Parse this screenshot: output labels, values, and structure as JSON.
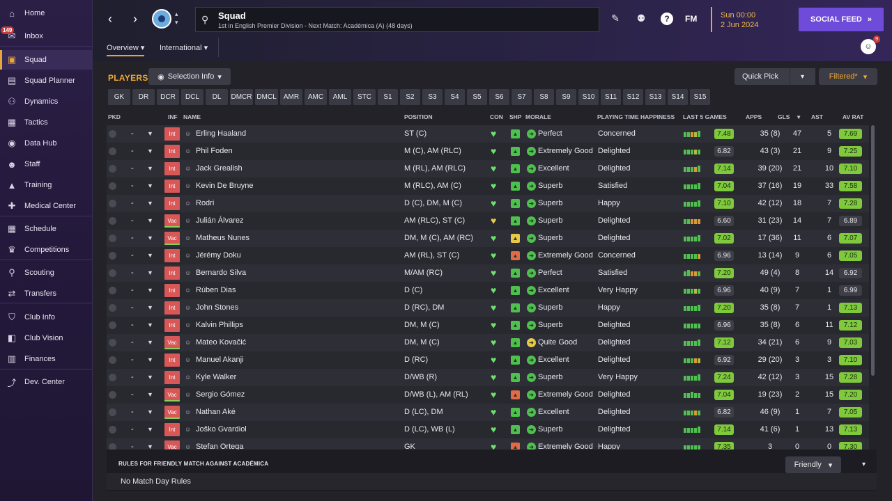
{
  "sidebar": {
    "items": [
      {
        "label": "Home",
        "icon": "home-icon",
        "glyph": "⌂"
      },
      {
        "label": "Inbox",
        "icon": "inbox-icon",
        "glyph": "✉",
        "badge": "149"
      },
      {
        "label": "Squad",
        "icon": "shirt-icon",
        "glyph": "▣",
        "active": true
      },
      {
        "label": "Squad Planner",
        "icon": "clipboard-icon",
        "glyph": "▤"
      },
      {
        "label": "Dynamics",
        "icon": "dynamics-icon",
        "glyph": "⚇"
      },
      {
        "label": "Tactics",
        "icon": "tactics-icon",
        "glyph": "▦"
      },
      {
        "label": "Data Hub",
        "icon": "data-hub-icon",
        "glyph": "◉"
      },
      {
        "label": "Staff",
        "icon": "staff-icon",
        "glyph": "☻"
      },
      {
        "label": "Training",
        "icon": "training-icon",
        "glyph": "▲"
      },
      {
        "label": "Medical Center",
        "icon": "medical-icon",
        "glyph": "✚"
      },
      {
        "label": "Schedule",
        "icon": "calendar-icon",
        "glyph": "▦"
      },
      {
        "label": "Competitions",
        "icon": "trophy-icon",
        "glyph": "♛"
      },
      {
        "label": "Scouting",
        "icon": "scouting-icon",
        "glyph": "⚲"
      },
      {
        "label": "Transfers",
        "icon": "transfers-icon",
        "glyph": "⇄"
      },
      {
        "label": "Club Info",
        "icon": "club-info-icon",
        "glyph": "⛉"
      },
      {
        "label": "Club Vision",
        "icon": "club-vision-icon",
        "glyph": "◧"
      },
      {
        "label": "Finances",
        "icon": "finances-icon",
        "glyph": "▥"
      },
      {
        "label": "Dev. Center",
        "icon": "dev-center-icon",
        "glyph": "⤴"
      }
    ]
  },
  "header": {
    "title": "Squad",
    "subtitle": "1st in English Premier Division - Next Match: Académica (A) (48 days)",
    "date_time": "Sun 00:00",
    "date": "2 Jun 2024",
    "social_label": "SOCIAL FEED",
    "fm_label": "FM",
    "help_label": "?",
    "notif_count": "9",
    "tabs": [
      {
        "label": "Overview"
      },
      {
        "label": "International"
      }
    ]
  },
  "toolbar": {
    "players_title": "PLAYERS",
    "selection_info": "Selection Info",
    "quick_pick": "Quick Pick",
    "filtered": "Filtered*",
    "positions": [
      "GK",
      "DR",
      "DCR",
      "DCL",
      "DL",
      "DMCR",
      "DMCL",
      "AMR",
      "AMC",
      "AML",
      "STC",
      "S1",
      "S2",
      "S3",
      "S4",
      "S5",
      "S6",
      "S7",
      "S8",
      "S9",
      "S10",
      "S11",
      "S12",
      "S13",
      "S14",
      "S15"
    ]
  },
  "table": {
    "columns": {
      "pkd": "PKD",
      "inf": "INF",
      "name": "NAME",
      "position": "POSITION",
      "con": "CON",
      "shp": "SHP",
      "morale": "MORALE",
      "pth": "PLAYING TIME HAPPINESS",
      "last5": "LAST 5 GAMES",
      "apps": "APPS",
      "gls": "GLS",
      "ast": "AST",
      "avrat": "AV RAT"
    },
    "rows": [
      {
        "dash": "-",
        "inf": "Int",
        "name": "Erling Haaland",
        "position": "ST (C)",
        "morale": "Perfect",
        "pth": "Concerned",
        "form": "7.48",
        "apps": "35 (8)",
        "gls": "47",
        "ast": "5",
        "avrat": "7.69"
      },
      {
        "dash": "-",
        "inf": "Int",
        "name": "Phil Foden",
        "position": "M (C), AM (RLC)",
        "morale": "Extremely Good",
        "pth": "Delighted",
        "form": "6.82",
        "apps": "43 (3)",
        "gls": "21",
        "ast": "9",
        "avrat": "7.25"
      },
      {
        "dash": "-",
        "inf": "Int",
        "name": "Jack Grealish",
        "position": "M (RL), AM (RLC)",
        "morale": "Excellent",
        "pth": "Delighted",
        "form": "7.14",
        "apps": "39 (20)",
        "gls": "21",
        "ast": "10",
        "avrat": "7.10"
      },
      {
        "dash": "-",
        "inf": "Int",
        "name": "Kevin De Bruyne",
        "position": "M (RLC), AM (C)",
        "morale": "Superb",
        "pth": "Satisfied",
        "form": "7.04",
        "apps": "37 (16)",
        "gls": "19",
        "ast": "33",
        "avrat": "7.58"
      },
      {
        "dash": "-",
        "inf": "Int",
        "name": "Rodri",
        "position": "D (C), DM, M (C)",
        "morale": "Superb",
        "pth": "Happy",
        "form": "7.10",
        "apps": "42 (12)",
        "gls": "18",
        "ast": "7",
        "avrat": "7.28"
      },
      {
        "dash": "-",
        "inf": "Vac",
        "name": "Julián Álvarez",
        "position": "AM (RLC), ST (C)",
        "morale": "Superb",
        "pth": "Delighted",
        "form": "6.60",
        "apps": "31 (23)",
        "gls": "14",
        "ast": "7",
        "avrat": "6.89"
      },
      {
        "dash": "-",
        "inf": "Vac",
        "name": "Matheus Nunes",
        "position": "DM, M (C), AM (RC)",
        "morale": "Superb",
        "pth": "Delighted",
        "form": "7.02",
        "apps": "17 (36)",
        "gls": "11",
        "ast": "6",
        "avrat": "7.07"
      },
      {
        "dash": "-",
        "inf": "Int",
        "name": "Jérémy Doku",
        "position": "AM (RL), ST (C)",
        "morale": "Extremely Good",
        "pth": "Concerned",
        "form": "6.96",
        "apps": "13 (14)",
        "gls": "9",
        "ast": "6",
        "avrat": "7.05"
      },
      {
        "dash": "-",
        "inf": "Int",
        "name": "Bernardo Silva",
        "position": "M/AM (RC)",
        "morale": "Perfect",
        "pth": "Satisfied",
        "form": "7.20",
        "apps": "49 (4)",
        "gls": "8",
        "ast": "14",
        "avrat": "6.92"
      },
      {
        "dash": "-",
        "inf": "Int",
        "name": "Rúben Dias",
        "position": "D (C)",
        "morale": "Excellent",
        "pth": "Very Happy",
        "form": "6.96",
        "apps": "40 (9)",
        "gls": "7",
        "ast": "1",
        "avrat": "6.99"
      },
      {
        "dash": "-",
        "inf": "Int",
        "name": "John Stones",
        "position": "D (RC), DM",
        "morale": "Superb",
        "pth": "Happy",
        "form": "7.20",
        "apps": "35 (8)",
        "gls": "7",
        "ast": "1",
        "avrat": "7.13"
      },
      {
        "dash": "-",
        "inf": "Int",
        "name": "Kalvin Phillips",
        "position": "DM, M (C)",
        "morale": "Superb",
        "pth": "Delighted",
        "form": "6.96",
        "apps": "35 (8)",
        "gls": "6",
        "ast": "11",
        "avrat": "7.12"
      },
      {
        "dash": "-",
        "inf": "Vac",
        "name": "Mateo Kovačić",
        "position": "DM, M (C)",
        "morale": "Quite Good",
        "pth": "Delighted",
        "form": "7.12",
        "apps": "34 (21)",
        "gls": "6",
        "ast": "9",
        "avrat": "7.03"
      },
      {
        "dash": "-",
        "inf": "Int",
        "name": "Manuel Akanji",
        "position": "D (RC)",
        "morale": "Excellent",
        "pth": "Delighted",
        "form": "6.92",
        "apps": "29 (20)",
        "gls": "3",
        "ast": "3",
        "avrat": "7.10"
      },
      {
        "dash": "-",
        "inf": "Int",
        "name": "Kyle Walker",
        "position": "D/WB (R)",
        "morale": "Superb",
        "pth": "Very Happy",
        "form": "7.24",
        "apps": "42 (12)",
        "gls": "3",
        "ast": "15",
        "avrat": "7.28"
      },
      {
        "dash": "-",
        "inf": "Vac",
        "name": "Sergio Gómez",
        "position": "D/WB (L), AM (RL)",
        "morale": "Extremely Good",
        "pth": "Delighted",
        "form": "7.04",
        "apps": "19 (23)",
        "gls": "2",
        "ast": "15",
        "avrat": "7.20"
      },
      {
        "dash": "-",
        "inf": "Vac",
        "name": "Nathan Aké",
        "position": "D (LC), DM",
        "morale": "Excellent",
        "pth": "Delighted",
        "form": "6.82",
        "apps": "46 (9)",
        "gls": "1",
        "ast": "7",
        "avrat": "7.05"
      },
      {
        "dash": "-",
        "inf": "Int",
        "name": "Joško Gvardiol",
        "position": "D (LC), WB (L)",
        "morale": "Superb",
        "pth": "Delighted",
        "form": "7.14",
        "apps": "41 (6)",
        "gls": "1",
        "ast": "13",
        "avrat": "7.13"
      },
      {
        "dash": "-",
        "inf": "Vac",
        "name": "Stefan Ortega",
        "position": "GK",
        "morale": "Extremely Good",
        "pth": "Happy",
        "form": "7.35",
        "apps": "3",
        "gls": "0",
        "ast": "0",
        "avrat": "7.30"
      }
    ]
  },
  "rules": {
    "title": "RULES FOR FRIENDLY MATCH AGAINST ACADÉMICA",
    "value": "No Match Day Rules",
    "dropdown": "Friendly"
  },
  "colors": {
    "accent": "#e8a53a",
    "social": "#6e4bd8",
    "rating_good": "#7ec93c",
    "int_badge": "#d85757"
  }
}
